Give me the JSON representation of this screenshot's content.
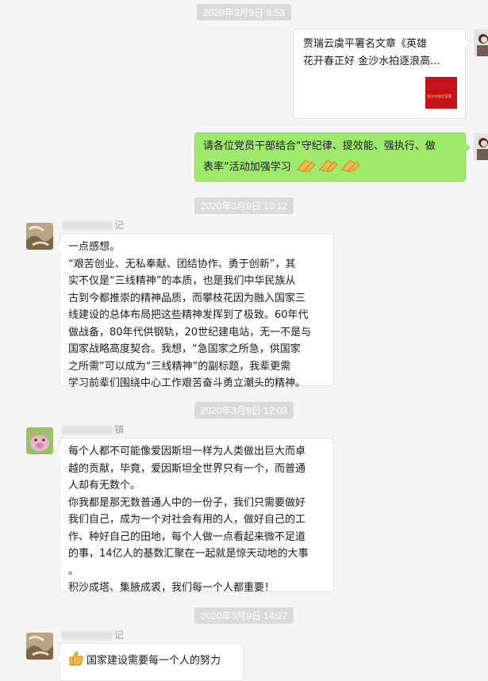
{
  "timestamps": [
    "2020年3月9日 9:53",
    "2020年3月9日 10:12",
    "2020年3月9日 12:03",
    "2020年3月9日 14:27"
  ],
  "messages": {
    "m1": {
      "avatar_icon": "self-avatar-icon",
      "link_title_line1": "贾瑞云虞平署名文章《英雄",
      "link_title_line2": "花开春正好 金沙水拍逐浪高...",
      "thumb_text": "金沙水拍云崖暖"
    },
    "m2": {
      "avatar_icon": "self-avatar-icon",
      "line1": "请各位党员干部结合“守纪律、提效能、强执行、做",
      "line2": "表率”活动加强学习",
      "emoji_icon": "clapping-hands-icon"
    },
    "m3": {
      "sender_suffix": "记",
      "avatar_icon": "landscape-avatar-icon",
      "lines": [
        "一点感想。",
        "“艰苦创业、无私奉献、团结协作、勇于创新”，其",
        "实不仅是“三线精神”的本质，也是我们中华民族从",
        "古到今都推崇的精神品质，而攀枝花因为融入国家三",
        "线建设的总体布局把这些精神发挥到了极致。60年代",
        "做战备，80年代供钢轨，20世纪建电站，无一不是与",
        "国家战略高度契合。我想，“急国家之所急，供国家",
        "之所需”可以成为“三线精神”的副标题，我辈更需",
        "学习前辈们围绕中心工作艰苦奋斗勇立潮头的精神。"
      ]
    },
    "m4": {
      "sender_suffix": "镇",
      "avatar_icon": "pig-avatar-icon",
      "lines": [
        "每个人都不可能像爱因斯坦一样为人类做出巨大而卓",
        "越的贡献，毕竟，爱因斯坦全世界只有一个，而普通",
        "人却有无数个。",
        "你我都是那无数普通人中的一份子，我们只需要做好",
        "我们自己，成为一个对社会有用的人，做好自己的工",
        "作、种好自己的田地，每个人做一点看起来微不足道",
        "的事，14亿人的基数汇聚在一起就是惊天动地的大事",
        "。",
        "积沙成塔、集腋成裘，我们每一个人都重要！"
      ]
    },
    "m5": {
      "sender_suffix": "记",
      "avatar_icon": "landscape-avatar-icon",
      "text": "国家建设需要每一个人的努力",
      "emoji_icon": "thumbs-up-icon"
    }
  },
  "colors": {
    "background": "#f5f5f5",
    "bubble_green": "#9eea6a",
    "bubble_white": "#ffffff",
    "timestamp_bg": "#dadada"
  }
}
